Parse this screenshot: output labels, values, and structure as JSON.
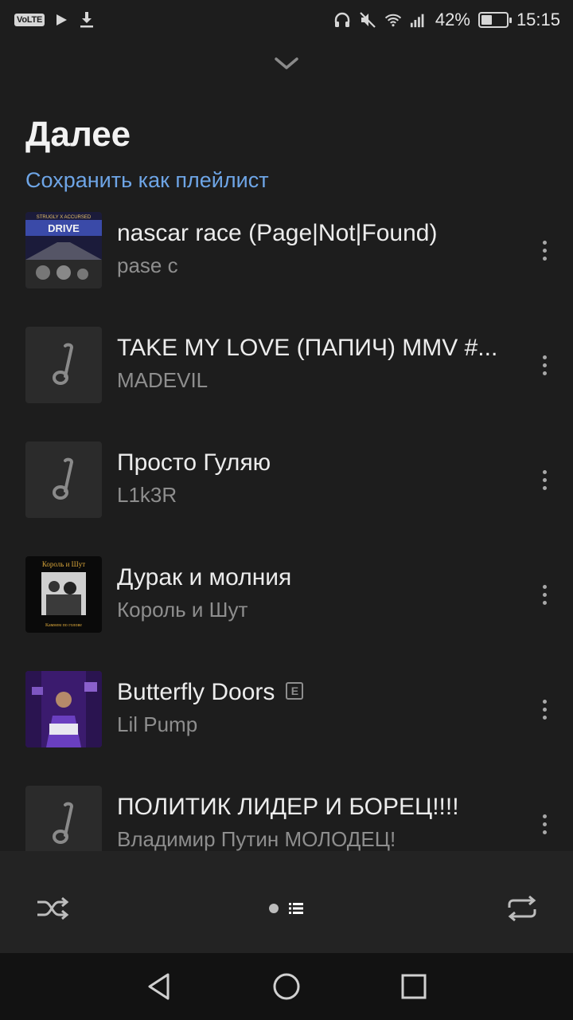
{
  "status_bar": {
    "volte": "VoLTE",
    "battery_percent": "42%",
    "battery_level": 0.42,
    "time": "15:15",
    "icons": [
      "play-icon",
      "download-icon",
      "headset-icon",
      "mute-icon",
      "wifi-icon",
      "signal-icon",
      "battery-icon"
    ]
  },
  "header": {
    "title": "Далее",
    "save_link": "Сохранить как плейлист"
  },
  "queue": [
    {
      "title": "nascar race (Page|Not|Found)",
      "artist": "pase c",
      "art": "drive-cover",
      "explicit": false
    },
    {
      "title": "TAKE MY LOVE (ПАПИЧ) MMV #...",
      "artist": "MADEVIL",
      "art": "placeholder",
      "explicit": false
    },
    {
      "title": "Просто Гуляю",
      "artist": "L1k3R",
      "art": "placeholder",
      "explicit": false
    },
    {
      "title": "Дурак и молния",
      "artist": "Король и Шут",
      "art": "kish-cover",
      "explicit": false
    },
    {
      "title": "Butterfly Doors",
      "artist": "Lil Pump",
      "art": "lilpump-cover",
      "explicit": true
    },
    {
      "title": "ПОЛИТИК ЛИДЕР И БОРЕЦ!!!!",
      "artist": "Владимир Путин МОЛОДЕЦ!",
      "art": "placeholder",
      "explicit": false
    }
  ],
  "covers": {
    "drive_top": "STRUGLY X ACCURSED",
    "drive_title": "DRIVE",
    "kish_top": "Король и Шут",
    "kish_bottom": "Камнем по голове"
  },
  "explicit_badge": "E",
  "colors": {
    "background": "#1d1d1d",
    "accent_link": "#6ea5e6",
    "controls_bg": "#232323",
    "navbar_bg": "#121212"
  }
}
